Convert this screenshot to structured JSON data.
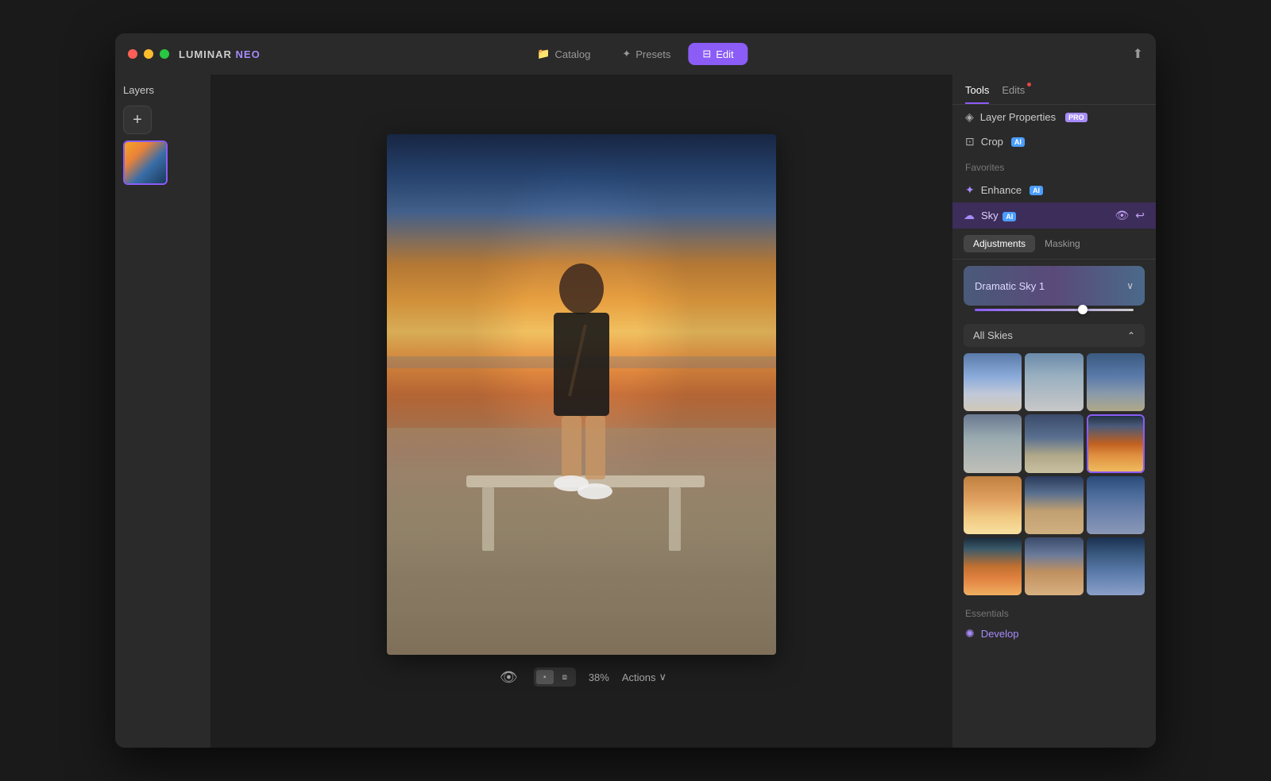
{
  "window": {
    "title": "LUMINAR NEO"
  },
  "titlebar": {
    "logo": "LUMINAR NEO",
    "tabs": [
      {
        "id": "catalog",
        "label": "Catalog",
        "icon": "📁",
        "active": false
      },
      {
        "id": "presets",
        "label": "Presets",
        "icon": "✦",
        "active": false
      },
      {
        "id": "edit",
        "label": "Edit",
        "icon": "⊟",
        "active": true
      }
    ],
    "share_icon": "⬆"
  },
  "layers": {
    "title": "Layers",
    "add_button": "+",
    "items": [
      {
        "id": "layer1",
        "type": "photo"
      }
    ]
  },
  "canvas": {
    "zoom": "38%",
    "actions_label": "Actions",
    "chevron": "∨"
  },
  "right_panel": {
    "tabs": [
      {
        "id": "tools",
        "label": "Tools",
        "active": true,
        "has_dot": false
      },
      {
        "id": "edits",
        "label": "Edits",
        "active": false,
        "has_dot": true
      }
    ],
    "tools_section": {
      "label": "",
      "items": [
        {
          "id": "layer-properties",
          "label": "Layer Properties",
          "icon": "◈",
          "badge": "PRO"
        },
        {
          "id": "crop",
          "label": "Crop",
          "icon": "⊡",
          "badge": "AI"
        }
      ]
    },
    "favorites_label": "Favorites",
    "enhance_item": {
      "label": "Enhance",
      "icon": "✦",
      "badge": "AI"
    },
    "sky_section": {
      "title": "Sky",
      "badge": "AI",
      "subtabs": [
        {
          "id": "adjustments",
          "label": "Adjustments",
          "active": true
        },
        {
          "id": "masking",
          "label": "Masking",
          "active": false
        }
      ],
      "preset_name": "Dramatic Sky 1",
      "all_skies_label": "All Skies",
      "sky_thumbs": [
        "sky-t1",
        "sky-t2",
        "sky-t3",
        "sky-t4",
        "sky-t5",
        "sky-t6",
        "sky-t7",
        "sky-t8",
        "sky-t9",
        "sky-t10",
        "sky-t11",
        "sky-t12"
      ],
      "selected_thumb": "sky-t6"
    },
    "essentials_label": "Essentials",
    "develop_label": "Develop",
    "develop_icon": "✺"
  }
}
